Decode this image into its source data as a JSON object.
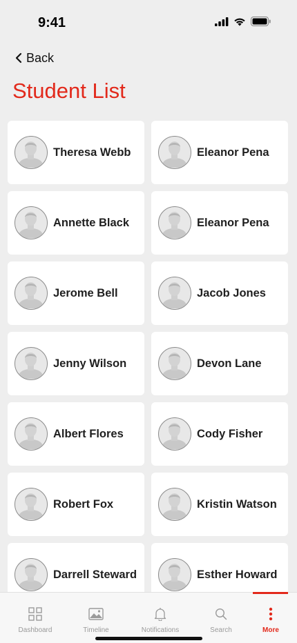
{
  "status_bar": {
    "time": "9:41"
  },
  "nav": {
    "back_label": "Back"
  },
  "page": {
    "title": "Student List"
  },
  "students": [
    "Theresa Webb",
    "Eleanor Pena",
    "Annette Black",
    "Eleanor Pena",
    "Jerome Bell",
    "Jacob Jones",
    "Jenny Wilson",
    "Devon Lane",
    "Albert Flores",
    "Cody Fisher",
    "Robert Fox",
    "Kristin Watson",
    "Darrell Steward",
    "Esther Howard"
  ],
  "tabs": [
    {
      "label": "Dashboard",
      "icon": "dashboard-icon"
    },
    {
      "label": "Timeline",
      "icon": "timeline-icon"
    },
    {
      "label": "Notifications",
      "icon": "bell-icon"
    },
    {
      "label": "Search",
      "icon": "search-icon"
    },
    {
      "label": "More",
      "icon": "more-icon",
      "active": true
    }
  ],
  "colors": {
    "accent": "#e2291b",
    "background": "#eeeeee",
    "card": "#ffffff"
  }
}
